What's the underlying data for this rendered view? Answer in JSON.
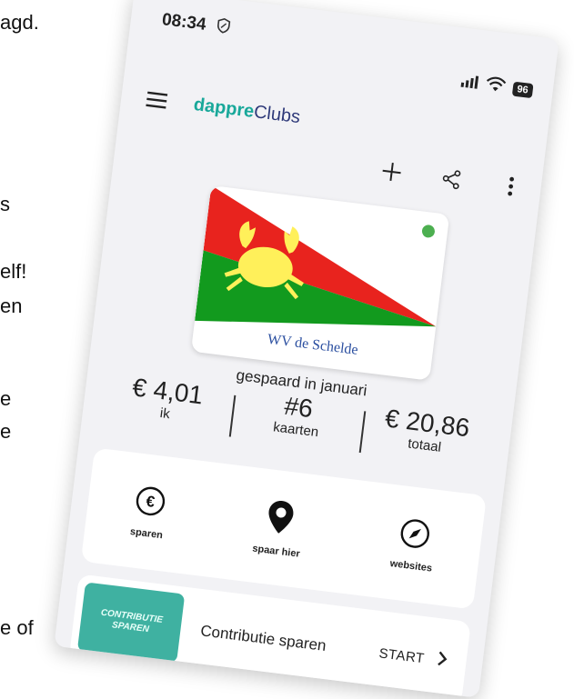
{
  "background_text": [
    "agd.",
    "s",
    "elf!",
    "en",
    "e",
    "e",
    "e of"
  ],
  "status_bar": {
    "time": "08:34",
    "battery": "96"
  },
  "app_bar": {
    "brand_part1": "dappre",
    "brand_part2": "Clubs"
  },
  "actions": {
    "icons": [
      "plus-icon",
      "share-icon",
      "more-vert-icon"
    ]
  },
  "club": {
    "name": "WV de Schelde",
    "active": true,
    "flag_colors": {
      "top": "#e8231e",
      "bottom": "#129a1e",
      "emblem": "#fff05a"
    }
  },
  "stats": {
    "caption": "gespaard in januari",
    "me_value": "€ 4,01",
    "me_label": "ik",
    "cards_value": "#6",
    "cards_label": "kaarten",
    "total_value": "€ 20,86",
    "total_label": "totaal"
  },
  "tiles": [
    {
      "label": "sparen",
      "icon": "euro-coin-icon"
    },
    {
      "label": "spaar hier",
      "icon": "map-pin-icon"
    },
    {
      "label": "websites",
      "icon": "compass-icon"
    }
  ],
  "promo": {
    "badge_text": "CONTRIBUTIE\nSPAREN",
    "title": "Contributie sparen",
    "cta": "START"
  },
  "colors": {
    "accent": "#19a89a",
    "brand_dark": "#2f3a7a",
    "promo": "#3fb1a1",
    "active_dot": "#4caf50"
  }
}
